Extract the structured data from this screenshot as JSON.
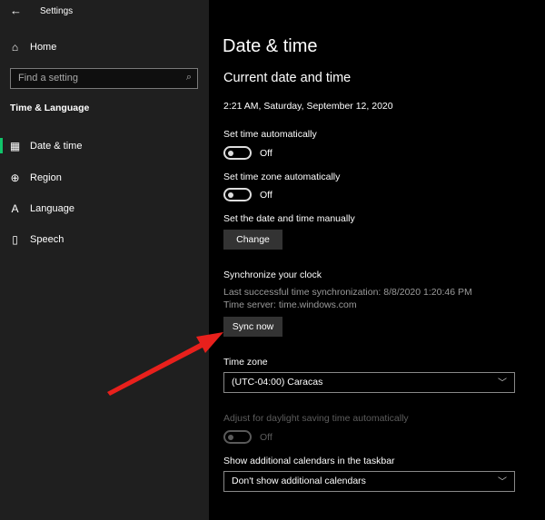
{
  "window": {
    "title": "Settings"
  },
  "sidebar": {
    "home": "Home",
    "search_placeholder": "Find a setting",
    "section": "Time & Language",
    "items": [
      {
        "label": "Date & time",
        "icon": "calendar-clock-icon"
      },
      {
        "label": "Region",
        "icon": "globe-icon"
      },
      {
        "label": "Language",
        "icon": "language-icon"
      },
      {
        "label": "Speech",
        "icon": "microphone-icon"
      }
    ]
  },
  "main": {
    "title": "Date & time",
    "subtitle": "Current date and time",
    "current": "2:21 AM, Saturday, September 12, 2020",
    "set_time_auto": "Set time automatically",
    "set_tz_auto": "Set time zone automatically",
    "off": "Off",
    "manual": "Set the date and time manually",
    "change": "Change",
    "sync_title": "Synchronize your clock",
    "last_sync": "Last successful time synchronization: 8/8/2020 1:20:46 PM",
    "server": "Time server: time.windows.com",
    "sync_now": "Sync now",
    "tz_label": "Time zone",
    "tz_value": "(UTC-04:00) Caracas",
    "dst": "Adjust for daylight saving time automatically",
    "cal_label": "Show additional calendars in the taskbar",
    "cal_value": "Don't show additional calendars"
  },
  "colors": {
    "accent": "#10c46a",
    "arrow": "#e8201c"
  }
}
